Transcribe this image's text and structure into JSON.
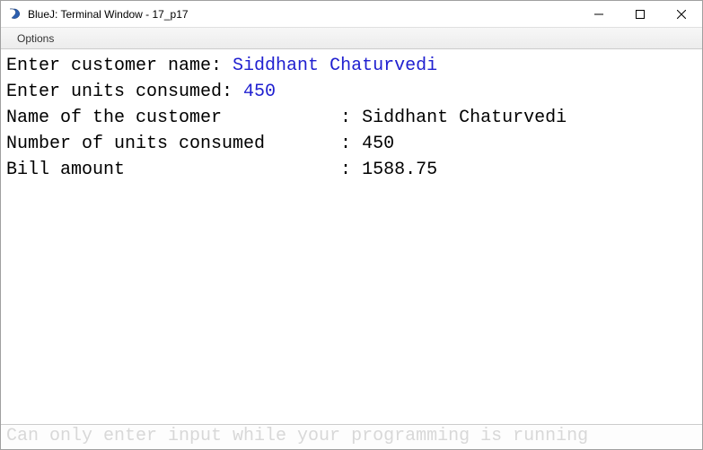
{
  "window": {
    "title": "BlueJ: Terminal Window - 17_p17"
  },
  "menu": {
    "options": "Options"
  },
  "terminal": {
    "line1_prompt": "Enter customer name: ",
    "line1_input": "Siddhant Chaturvedi",
    "line2_prompt": "Enter units consumed: ",
    "line2_input": "450",
    "line3": "Name of the customer           : Siddhant Chaturvedi",
    "line4": "Number of units consumed       : 450",
    "line5": "Bill amount                    : 1588.75"
  },
  "status": {
    "message": "Can only enter input while your programming is running"
  }
}
